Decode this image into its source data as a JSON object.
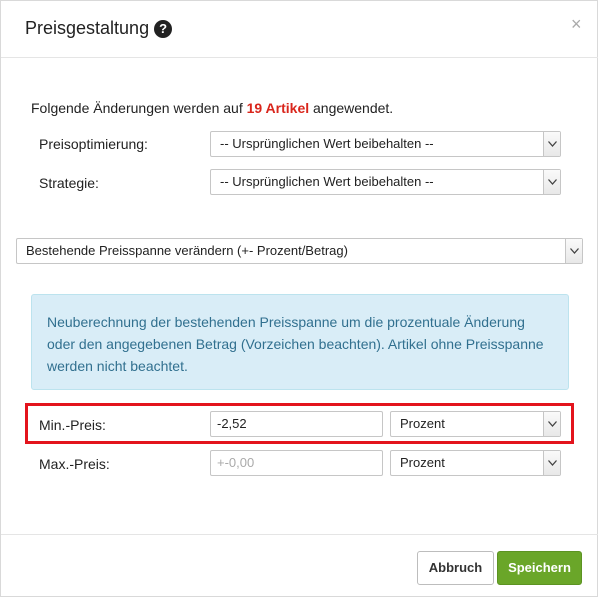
{
  "dialog": {
    "title": "Preisgestaltung",
    "help_icon": "question-circle-icon",
    "close_icon": "×"
  },
  "intro": {
    "prefix": "Folgende Änderungen werden auf ",
    "count_text": "19 Artikel",
    "suffix": " angewendet.",
    "count_color": "#d9261c"
  },
  "price_optimization": {
    "label": "Preisoptimierung:",
    "value": "-- Ursprünglichen Wert beibehalten --"
  },
  "strategy": {
    "label": "Strategie:",
    "value": "-- Ursprünglichen Wert beibehalten --"
  },
  "span_mode": {
    "value": "Bestehende Preisspanne verändern (+- Prozent/Betrag)"
  },
  "info_box": {
    "text": "Neuberechnung der bestehenden Preisspanne um die prozentuale Änderung oder den angegebenen Betrag (Vorzeichen beachten). Artikel ohne Preisspanne werden nicht beachtet.",
    "background": "#d9edf7",
    "color": "#31708f"
  },
  "min_price": {
    "label": "Min.-Preis:",
    "value": "-2,52",
    "unit": "Prozent"
  },
  "max_price": {
    "label": "Max.-Preis:",
    "placeholder": "+-0,00",
    "unit": "Prozent"
  },
  "footer": {
    "cancel_label": "Abbruch",
    "save_label": "Speichern",
    "save_color": "#6aa629"
  },
  "highlight_color": "#e3141d"
}
